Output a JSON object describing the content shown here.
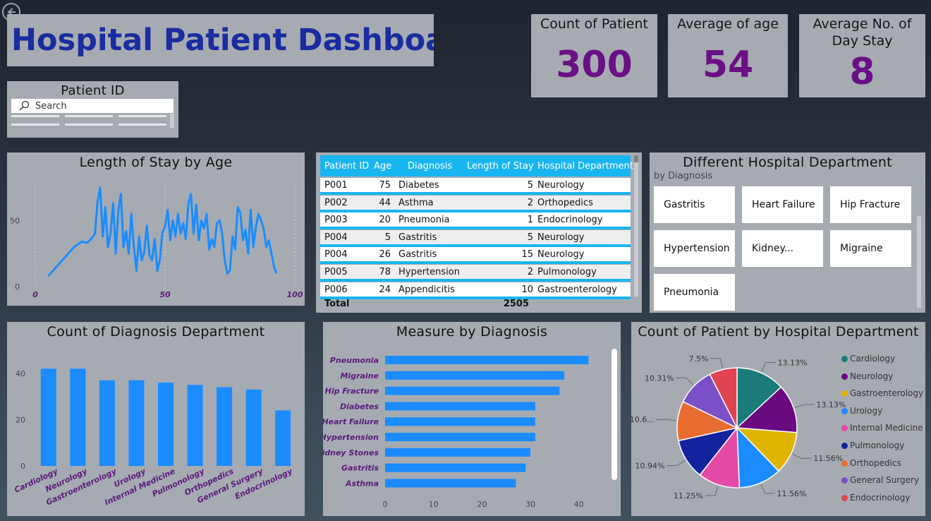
{
  "header": {
    "title": "Hospital Patient Dashboard"
  },
  "kpis": [
    {
      "label": "Count of Patient",
      "value": "300"
    },
    {
      "label": "Average of age",
      "value": "54"
    },
    {
      "label": "Average No. of Day Stay",
      "value": "8"
    }
  ],
  "patient_slicer": {
    "title": "Patient ID",
    "placeholder": "Search"
  },
  "line_card": {
    "title": "Length of Stay by Age"
  },
  "table": {
    "columns": [
      "Patient ID",
      "Age",
      "Diagnosis",
      "Length of Stay",
      "Hospital Department"
    ],
    "rows": [
      [
        "P001",
        "75",
        "Diabetes",
        "5",
        "Neurology"
      ],
      [
        "P002",
        "44",
        "Asthma",
        "2",
        "Orthopedics"
      ],
      [
        "P003",
        "20",
        "Pneumonia",
        "1",
        "Endocrinology"
      ],
      [
        "P004",
        "5",
        "Gastritis",
        "5",
        "Neurology"
      ],
      [
        "P004",
        "26",
        "Gastritis",
        "15",
        "Neurology"
      ],
      [
        "P005",
        "78",
        "Hypertension",
        "2",
        "Pulmonology"
      ],
      [
        "P006",
        "24",
        "Appendicitis",
        "10",
        "Gastroenterology"
      ]
    ],
    "total_label": "Total",
    "total_value": "2505"
  },
  "dept_slicer": {
    "title": "Different Hospital Department",
    "subtitle": "by Diagnosis",
    "items": [
      "Gastritis",
      "Heart Failure",
      "Hip Fracture",
      "Hypertension",
      "Kidney...",
      "Migraine",
      "Pneumonia"
    ]
  },
  "bar_card": {
    "title": "Count of Diagnosis Department"
  },
  "hbar_card": {
    "title": "Measure by Diagnosis"
  },
  "pie_card": {
    "title": "Count of Patient by Hospital Department"
  },
  "colors": {
    "accent": "#1a8cff",
    "kpi": "#6a0f86",
    "title": "#1a2ca0",
    "header_row": "#18b6f0"
  },
  "chart_data": [
    {
      "type": "line",
      "title": "Length of Stay by Age",
      "xlim": [
        0,
        100
      ],
      "ylim": [
        0,
        80
      ],
      "x_ticks": [
        0,
        50,
        100
      ],
      "y_ticks": [
        0,
        50
      ],
      "color": "#1a8cff",
      "points": [
        [
          5,
          8
        ],
        [
          15,
          30
        ],
        [
          18,
          34
        ],
        [
          20,
          33
        ],
        [
          22,
          37
        ],
        [
          23,
          40
        ],
        [
          24,
          64
        ],
        [
          25,
          75
        ],
        [
          26,
          38
        ],
        [
          27,
          60
        ],
        [
          28,
          30
        ],
        [
          29,
          40
        ],
        [
          30,
          63
        ],
        [
          31,
          25
        ],
        [
          32,
          58
        ],
        [
          33,
          70
        ],
        [
          34,
          30
        ],
        [
          35,
          42
        ],
        [
          36,
          25
        ],
        [
          37,
          55
        ],
        [
          38,
          30
        ],
        [
          39,
          12
        ],
        [
          40,
          38
        ],
        [
          41,
          20
        ],
        [
          42,
          26
        ],
        [
          43,
          46
        ],
        [
          44,
          24
        ],
        [
          45,
          20
        ],
        [
          46,
          36
        ],
        [
          47,
          12
        ],
        [
          48,
          20
        ],
        [
          49,
          41
        ],
        [
          50,
          45
        ],
        [
          51,
          58
        ],
        [
          52,
          35
        ],
        [
          53,
          50
        ],
        [
          54,
          38
        ],
        [
          55,
          55
        ],
        [
          56,
          40
        ],
        [
          57,
          48
        ],
        [
          58,
          36
        ],
        [
          59,
          63
        ],
        [
          60,
          70
        ],
        [
          61,
          40
        ],
        [
          62,
          62
        ],
        [
          63,
          35
        ],
        [
          64,
          50
        ],
        [
          65,
          44
        ],
        [
          66,
          55
        ],
        [
          67,
          28
        ],
        [
          68,
          36
        ],
        [
          69,
          30
        ],
        [
          70,
          48
        ],
        [
          71,
          50
        ],
        [
          72,
          40
        ],
        [
          73,
          20
        ],
        [
          74,
          10
        ],
        [
          75,
          12
        ],
        [
          76,
          38
        ],
        [
          77,
          28
        ],
        [
          78,
          60
        ],
        [
          79,
          56
        ],
        [
          80,
          35
        ],
        [
          81,
          43
        ],
        [
          82,
          25
        ],
        [
          83,
          58
        ],
        [
          84,
          30
        ],
        [
          85,
          45
        ],
        [
          86,
          55
        ],
        [
          87,
          50
        ],
        [
          88,
          44
        ],
        [
          89,
          30
        ],
        [
          90,
          35
        ],
        [
          92,
          15
        ],
        [
          93,
          10
        ]
      ]
    },
    {
      "type": "bar",
      "title": "Count of Diagnosis Department",
      "categories": [
        "Cardiology",
        "Neurology",
        "Gastroenterology",
        "Urology",
        "Internal Medicine",
        "Pulmonology",
        "Orthopedics",
        "General Surgery",
        "Endocrinology"
      ],
      "values": [
        42,
        42,
        37,
        37,
        36,
        35,
        34,
        33,
        24
      ],
      "ylim": [
        0,
        50
      ],
      "y_ticks": [
        0,
        20,
        40
      ],
      "color": "#1a8cff"
    },
    {
      "type": "bar",
      "orientation": "horizontal",
      "title": "Measure by Diagnosis",
      "categories": [
        "Pneumonia",
        "Migraine",
        "Hip Fracture",
        "Diabetes",
        "Heart Failure",
        "Hypertension",
        "Kidney Stones",
        "Gastritis",
        "Asthma"
      ],
      "values": [
        42,
        37,
        36,
        31,
        31,
        31,
        30,
        29,
        27
      ],
      "xlim": [
        0,
        45
      ],
      "x_ticks": [
        0,
        10,
        20,
        30,
        40
      ],
      "color": "#1a8cff"
    },
    {
      "type": "pie",
      "title": "Count of Patient by Hospital Department",
      "legend_position": "right",
      "slices": [
        {
          "label": "Cardiology",
          "value": 13.13,
          "display": "13.13%",
          "color": "#1b7a7a"
        },
        {
          "label": "Neurology",
          "value": 13.13,
          "display": "13.13%",
          "color": "#6a0a80"
        },
        {
          "label": "Gastroenterology",
          "value": 11.56,
          "display": "11.56%",
          "color": "#e0b400"
        },
        {
          "label": "Urology",
          "value": 11.56,
          "display": "11.56%",
          "color": "#1a8cff"
        },
        {
          "label": "Internal Medicine",
          "value": 11.25,
          "display": "11.25%",
          "color": "#e64aa8"
        },
        {
          "label": "Pulmonology",
          "value": 10.94,
          "display": "10.94%",
          "color": "#12239e"
        },
        {
          "label": "Orthopedics",
          "value": 10.63,
          "display": "10.6...",
          "color": "#e86c30"
        },
        {
          "label": "General Surgery",
          "value": 10.31,
          "display": "10.31%",
          "color": "#7b4fc8"
        },
        {
          "label": "Endocrinology",
          "value": 7.5,
          "display": "7.5%",
          "color": "#e04450"
        }
      ]
    }
  ]
}
